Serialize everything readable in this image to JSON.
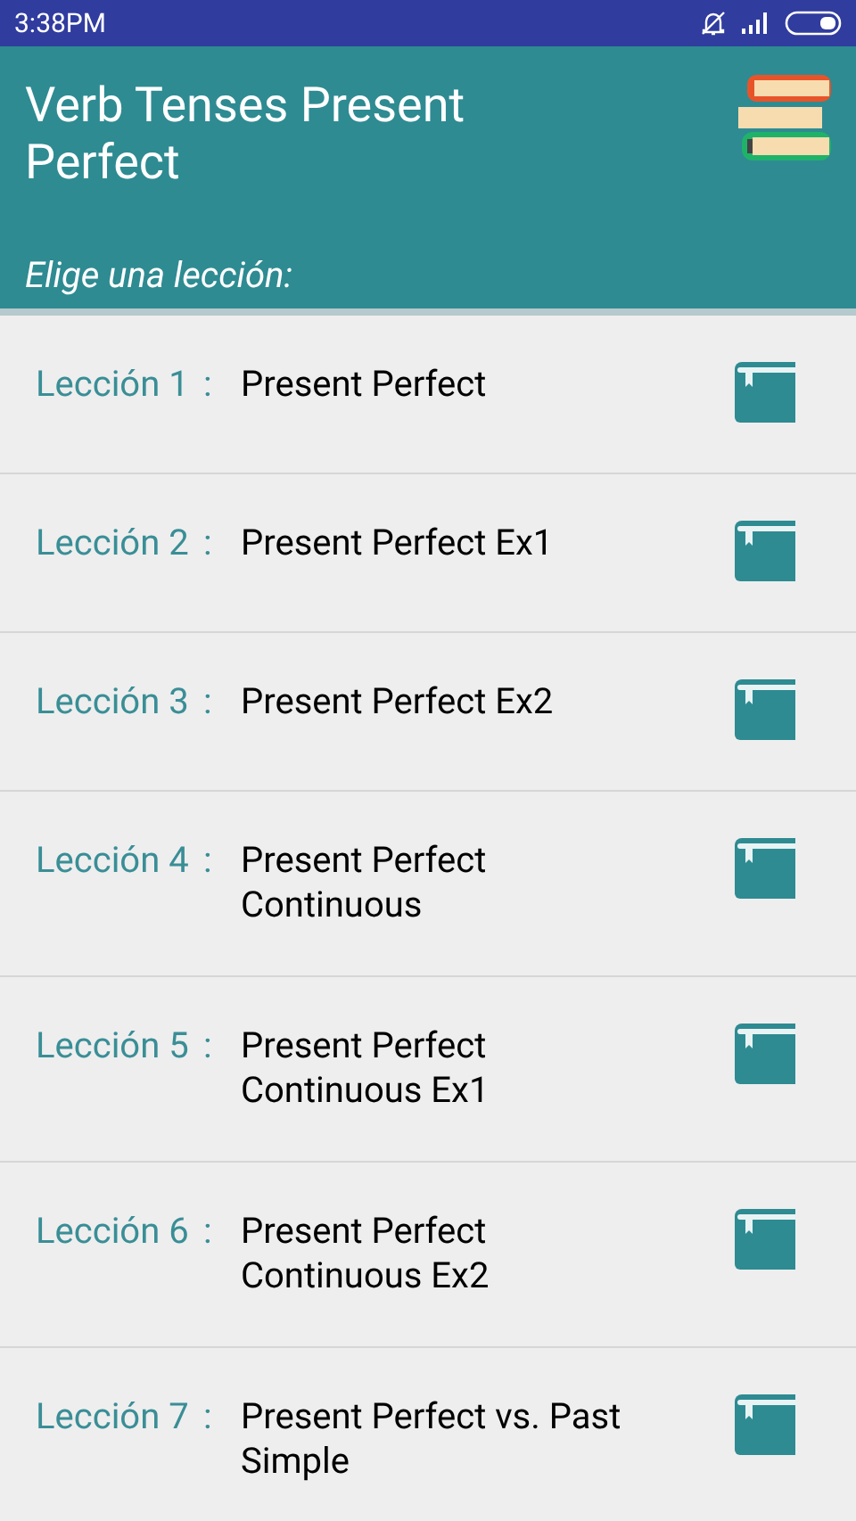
{
  "status_bar": {
    "time": "3:38PM"
  },
  "header": {
    "title": "Verb Tenses Present Perfect",
    "subtitle": "Elige una lección:"
  },
  "lessons": [
    {
      "label": "Lección 1",
      "separator": ":",
      "title": "Present Perfect"
    },
    {
      "label": "Lección 2",
      "separator": ":",
      "title": "Present Perfect Ex1"
    },
    {
      "label": "Lección 3",
      "separator": ":",
      "title": "Present Perfect Ex2"
    },
    {
      "label": "Lección 4",
      "separator": ":",
      "title": "Present Perfect Continuous"
    },
    {
      "label": "Lección 5",
      "separator": ":",
      "title": "Present Perfect Continuous Ex1"
    },
    {
      "label": "Lección 6",
      "separator": ":",
      "title": "Present Perfect Continuous Ex2"
    },
    {
      "label": "Lección 7",
      "separator": ":",
      "title": "Present Perfect vs. Past Simple"
    }
  ]
}
